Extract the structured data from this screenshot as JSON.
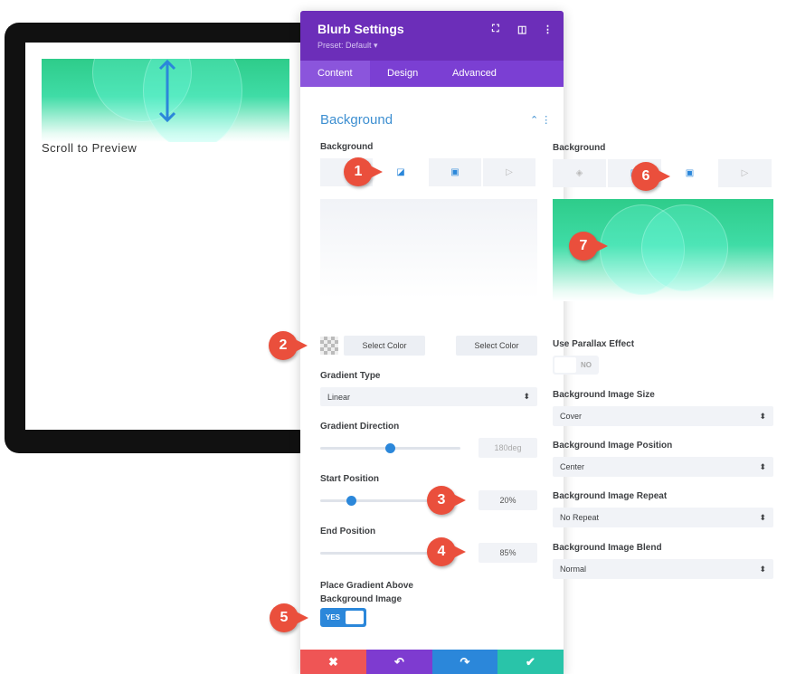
{
  "preview": {
    "text": "Scroll to Preview"
  },
  "panel": {
    "title": "Blurb Settings",
    "preset": "Preset: Default ▾",
    "tabs": [
      {
        "label": "Content",
        "active": true
      },
      {
        "label": "Design"
      },
      {
        "label": "Advanced"
      }
    ],
    "section_title": "Background",
    "background_label": "Background",
    "select_color_1": "Select Color",
    "select_color_2": "Select Color",
    "gradient_type": {
      "label": "Gradient Type",
      "value": "Linear"
    },
    "gradient_direction": {
      "label": "Gradient Direction",
      "value": "180deg",
      "percent": 50
    },
    "start_position": {
      "label": "Start Position",
      "value": "20%"
    },
    "end_position": {
      "label": "End Position",
      "value": "85%"
    },
    "place_gradient": {
      "label": "Place Gradient Above Background Image",
      "value": "YES"
    },
    "footer": {
      "colors": {
        "cancel": "#ef5555",
        "undo": "#7e3bd0",
        "redo": "#2b87da",
        "save": "#29c4a9"
      }
    }
  },
  "right": {
    "background_label": "Background",
    "parallax": {
      "label": "Use Parallax Effect",
      "value": "NO"
    },
    "size": {
      "label": "Background Image Size",
      "value": "Cover"
    },
    "position": {
      "label": "Background Image Position",
      "value": "Center"
    },
    "repeat": {
      "label": "Background Image Repeat",
      "value": "No Repeat"
    },
    "blend": {
      "label": "Background Image Blend",
      "value": "Normal"
    }
  },
  "markers": [
    "1",
    "2",
    "3",
    "4",
    "5",
    "6",
    "7"
  ],
  "colors": {
    "header": "#6c2eb9",
    "accent": "#2b87da",
    "marker": "#ea4f3c"
  }
}
